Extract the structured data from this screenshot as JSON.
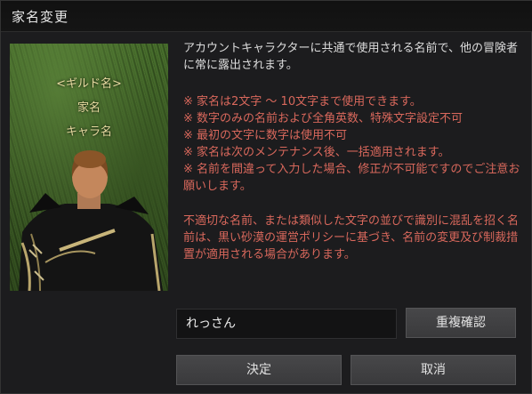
{
  "dialog": {
    "title": "家名変更"
  },
  "portrait": {
    "guild_label": "<ギルド名>",
    "family_label": "家名",
    "character_label": "キャラ名"
  },
  "info": {
    "intro": "アカウントキャラクターに共通で使用される名前で、他の冒険者に常に露出されます。",
    "rules": [
      "※ 家名は2文字 ～ 10文字まで使用できます。",
      "※ 数字のみの名前および全角英数、特殊文字設定不可",
      "※ 最初の文字に数字は使用不可",
      "※ 家名は次のメンテナンス後、一括適用されます。",
      "※ 名前を間違って入力した場合、修正が不可能ですのでご注意お願いします。"
    ],
    "warning": "不適切な名前、または類似した文字の並びで識別に混乱を招く名前は、黒い砂漠の運営ポリシーに基づき、名前の変更及び制裁措置が適用される場合があります。"
  },
  "form": {
    "name_value": "れっさん",
    "duplicate_check_label": "重複確認",
    "confirm_label": "決定",
    "cancel_label": "取消"
  }
}
